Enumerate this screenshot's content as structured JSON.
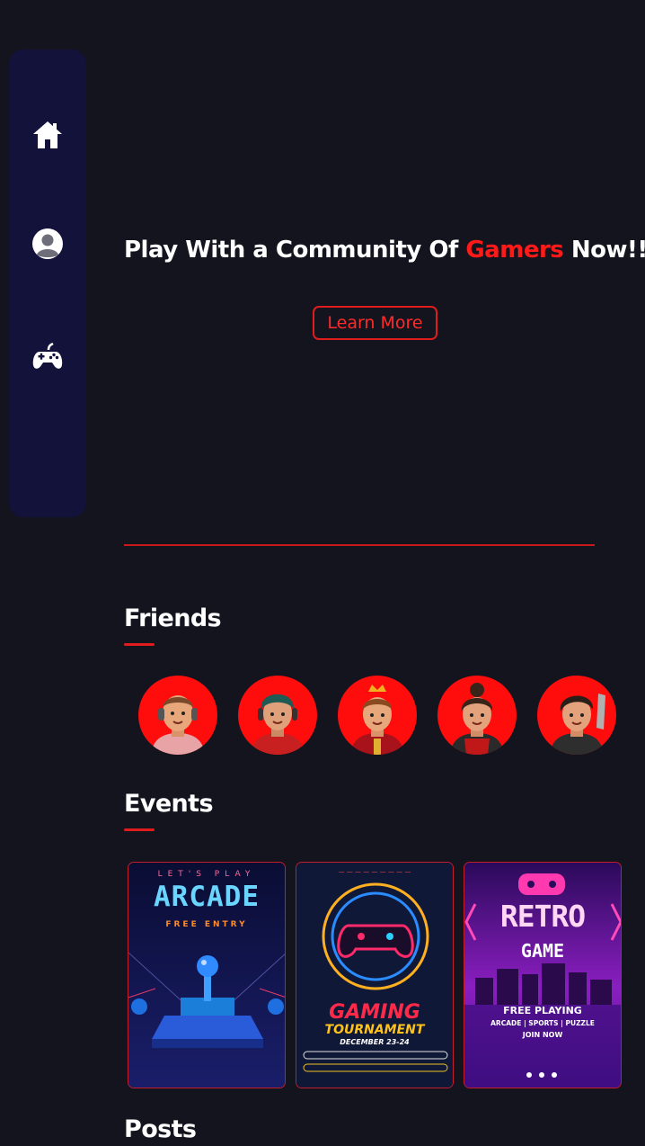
{
  "sidebar": {
    "items": [
      {
        "name": "home",
        "icon": "home-icon"
      },
      {
        "name": "profile",
        "icon": "user-circle-icon"
      },
      {
        "name": "games",
        "icon": "gamepad-icon"
      }
    ]
  },
  "hero": {
    "title_before": "Play With a Community Of ",
    "title_accent": "Gamers",
    "title_after": " Now!!",
    "button_label": "Learn More"
  },
  "friends": {
    "title": "Friends",
    "avatars": [
      {
        "icon": "avatar-boy-headphones"
      },
      {
        "icon": "avatar-boy-green-hair"
      },
      {
        "icon": "avatar-boy-crown"
      },
      {
        "icon": "avatar-girl-bun"
      },
      {
        "icon": "avatar-boy-sword"
      }
    ]
  },
  "events": {
    "title": "Events",
    "posters": [
      {
        "top_text": "LET'S PLAY",
        "title": "ARCADE",
        "subtitle": "FREE ENTRY"
      },
      {
        "title": "GAMING",
        "subtitle": "TOURNAMENT",
        "date": "DECEMBER 23-24"
      },
      {
        "title": "RETRO",
        "subtitle": "GAME",
        "line1": "FREE PLAYING",
        "line2": "ARCADE | SPORTS | PUZZLE",
        "line3": "JOIN NOW"
      }
    ]
  },
  "posts": {
    "title": "Posts"
  },
  "colors": {
    "background": "#14141f",
    "sidebar": "#12123a",
    "accent": "#e01c1c"
  }
}
